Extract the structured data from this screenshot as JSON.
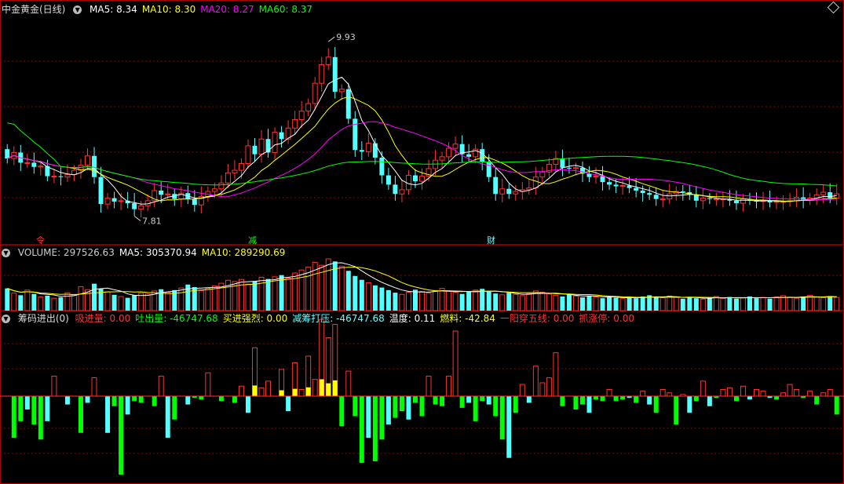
{
  "stock": {
    "title": "中金黄金(日线)"
  },
  "main_panel": {
    "ma_labels": [
      {
        "label": "MA5: 8.34",
        "color": "#ffffff"
      },
      {
        "label": "MA10: 8.30",
        "color": "#ffff00"
      },
      {
        "label": "MA20: 8.27",
        "color": "#ff00ff"
      },
      {
        "label": "MA60: 8.37",
        "color": "#00ff00"
      }
    ],
    "high_label": "9.93",
    "low_label": "7.81",
    "markers": [
      "令",
      "减",
      "财"
    ]
  },
  "volume_panel": {
    "labels": [
      {
        "label": "VOLUME: 297526.63",
        "color": "#cccccc"
      },
      {
        "label": "MA5: 305370.94",
        "color": "#ffffff"
      },
      {
        "label": "MA10: 289290.69",
        "color": "#ffff00"
      }
    ]
  },
  "indicator_panel": {
    "title": "筹码进出(0)",
    "labels": [
      {
        "label": "吸进量: 0.00",
        "color": "#ff3333"
      },
      {
        "label": "吐出量: -46747.68",
        "color": "#00ff00"
      },
      {
        "label": "买进强烈: 0.00",
        "color": "#ffff00"
      },
      {
        "label": "减筹打压: -46747.68",
        "color": "#66ffff"
      },
      {
        "label": "温度: 0.11",
        "color": "#ffffff"
      },
      {
        "label": "燃料: -42.84",
        "color": "#ffff00"
      },
      {
        "label": "一阳穿五线: 0.00",
        "color": "#ff3333"
      },
      {
        "label": "抓涨停: 0.00",
        "color": "#ff3333"
      }
    ]
  },
  "colors": {
    "up": "#ff3232",
    "down": "#54ffff",
    "ma5": "#ffffff",
    "ma10": "#ffff00",
    "ma20": "#ff00ff",
    "ma60": "#00ff00",
    "grid": "#8b0000"
  },
  "chart_data": {
    "type": "candlestick",
    "ylim": [
      7.6,
      10.2
    ],
    "open": [
      8.62,
      8.51,
      8.58,
      8.46,
      8.46,
      8.41,
      8.42,
      8.3,
      8.3,
      8.29,
      8.32,
      8.37,
      8.43,
      8.54,
      8.29,
      7.97,
      8.04,
      8.0,
      8.01,
      7.98,
      7.91,
      7.95,
      8.01,
      8.13,
      8.08,
      8.09,
      8.03,
      8.1,
      8.03,
      7.96,
      8.06,
      8.12,
      8.15,
      8.22,
      8.34,
      8.37,
      8.45,
      8.66,
      8.56,
      8.74,
      8.58,
      8.82,
      8.74,
      8.87,
      8.97,
      9.07,
      9.16,
      9.4,
      9.62,
      9.71,
      9.3,
      9.33,
      8.98,
      8.61,
      8.59,
      8.69,
      8.52,
      8.31,
      8.2,
      8.09,
      8.14,
      8.31,
      8.24,
      8.3,
      8.39,
      8.49,
      8.53,
      8.63,
      8.68,
      8.56,
      8.53,
      8.62,
      8.47,
      8.29,
      8.09,
      8.15,
      8.09,
      8.12,
      8.14,
      8.16,
      8.29,
      8.35,
      8.44,
      8.51,
      8.4,
      8.39,
      8.4,
      8.33,
      8.29,
      8.3,
      8.23,
      8.2,
      8.18,
      8.19,
      8.16,
      8.13,
      8.1,
      8.08,
      8.03,
      8.03,
      8.09,
      8.12,
      8.11,
      8.08,
      8.01,
      8.04,
      8.03,
      8.03,
      8.03,
      8.01,
      7.98,
      8.03,
      8.02,
      8.0,
      8.01,
      7.99,
      8.0,
      8.0,
      8.01,
      8.05,
      8.02,
      8.04,
      8.08,
      8.11,
      8.04
    ],
    "close": [
      8.51,
      8.58,
      8.46,
      8.46,
      8.41,
      8.42,
      8.3,
      8.3,
      8.29,
      8.32,
      8.37,
      8.43,
      8.54,
      8.29,
      7.97,
      8.04,
      8.0,
      8.01,
      7.98,
      7.91,
      7.95,
      8.01,
      8.13,
      8.08,
      8.09,
      8.03,
      8.1,
      8.03,
      7.96,
      8.06,
      8.12,
      8.15,
      8.22,
      8.34,
      8.37,
      8.45,
      8.66,
      8.56,
      8.74,
      8.58,
      8.82,
      8.74,
      8.87,
      8.97,
      9.07,
      9.16,
      9.4,
      9.62,
      9.71,
      9.3,
      9.33,
      8.98,
      8.61,
      8.59,
      8.69,
      8.52,
      8.31,
      8.2,
      8.09,
      8.14,
      8.31,
      8.24,
      8.3,
      8.39,
      8.49,
      8.53,
      8.63,
      8.68,
      8.56,
      8.53,
      8.62,
      8.47,
      8.29,
      8.09,
      8.15,
      8.09,
      8.12,
      8.14,
      8.16,
      8.29,
      8.35,
      8.44,
      8.51,
      8.4,
      8.39,
      8.4,
      8.33,
      8.29,
      8.3,
      8.23,
      8.2,
      8.18,
      8.19,
      8.16,
      8.13,
      8.1,
      8.08,
      8.03,
      8.03,
      8.09,
      8.12,
      8.11,
      8.08,
      8.01,
      8.04,
      8.03,
      8.03,
      8.03,
      8.01,
      7.98,
      8.03,
      8.02,
      8.0,
      8.01,
      7.99,
      8.0,
      8.0,
      8.01,
      8.05,
      8.02,
      8.04,
      8.08,
      8.11,
      8.04,
      8.09
    ],
    "volume": [
      5.2,
      4.1,
      3.6,
      4.8,
      3.9,
      3.2,
      3.5,
      2.9,
      3.1,
      4.2,
      3.8,
      5.6,
      4.9,
      6.3,
      5.1,
      4.4,
      3.7,
      3.3,
      3.0,
      3.6,
      4.1,
      3.9,
      4.6,
      5.0,
      4.3,
      4.8,
      5.3,
      6.1,
      5.5,
      4.7,
      5.2,
      5.8,
      6.4,
      7.1,
      6.8,
      7.3,
      6.2,
      6.9,
      7.8,
      7.4,
      7.9,
      8.3,
      7.6,
      8.8,
      9.5,
      10.2,
      11.3,
      10.6,
      12.1,
      11.5,
      10.4,
      9.3,
      8.1,
      7.2,
      6.5,
      5.9,
      5.4,
      4.8,
      4.2,
      3.8,
      4.3,
      4.9,
      4.5,
      4.1,
      4.7,
      5.2,
      4.6,
      4.3,
      3.9,
      4.4,
      4.8,
      5.1,
      4.5,
      4.0,
      3.7,
      4.2,
      3.8,
      3.5,
      4.0,
      4.6,
      4.3,
      3.9,
      3.6,
      3.3,
      3.8,
      3.4,
      3.1,
      3.5,
      3.2,
      2.9,
      3.3,
      3.0,
      2.8,
      3.1,
      2.9,
      3.3,
      3.6,
      3.2,
      3.0,
      3.4,
      3.1,
      2.8,
      3.2,
      2.9,
      2.7,
      3.0,
      3.3,
      2.9,
      3.2,
      2.8,
      3.0,
      3.3,
      2.9,
      3.1,
      2.8,
      3.2,
      3.5,
      3.1,
      2.9,
      3.3,
      3.6,
      3.2,
      3.0,
      3.4,
      3.1
    ],
    "indicator": [
      0,
      -2.5,
      -1.5,
      -0.8,
      -1.7,
      -2.6,
      -1.5,
      1.2,
      0,
      -0.5,
      0,
      -2.2,
      -0.4,
      1.1,
      0,
      -2.2,
      -0.6,
      -4.7,
      -1.1,
      -0.3,
      -0.4,
      0,
      -0.6,
      1.2,
      -2.5,
      -1.4,
      0,
      -0.5,
      -0.1,
      -0.2,
      1.4,
      0,
      -0.3,
      0,
      -0.4,
      0.6,
      -1.0,
      2.9,
      0.5,
      0.9,
      0,
      1.6,
      -0.9,
      2.0,
      0.4,
      2.4,
      1.0,
      4.6,
      3.5,
      4.3,
      -1.8,
      1.5,
      -1.2,
      -4.0,
      -2.5,
      -3.9,
      -2.6,
      -1.7,
      -1.3,
      -0.9,
      -1.4,
      -0.4,
      -1.2,
      1.2,
      -0.5,
      -0.6,
      1.2,
      3.9,
      -0.7,
      -0.4,
      -1.5,
      -0.3,
      -0.5,
      -1.2,
      -2.6,
      -3.7,
      -1.0,
      0.7,
      -0.4,
      1.8,
      0.8,
      1.1,
      2.6,
      -0.6,
      0,
      -0.8,
      -0.5,
      -1.0,
      -0.2,
      -0.3,
      0.4,
      -0.3,
      -0.2,
      -0.1,
      -0.4,
      0.3,
      -0.5,
      -1.0,
      0.4,
      0.2,
      -1.7,
      0.1,
      -1.0,
      -0.3,
      0.9,
      -0.6,
      -0.1,
      0.4,
      0.5,
      -0.3,
      0.6,
      -0.2,
      0.4,
      0.3,
      -0.1,
      -0.2,
      0.2,
      0.7,
      0.4,
      -0.1,
      0.3,
      -0.5,
      0.2,
      0.4,
      -1.1
    ]
  }
}
